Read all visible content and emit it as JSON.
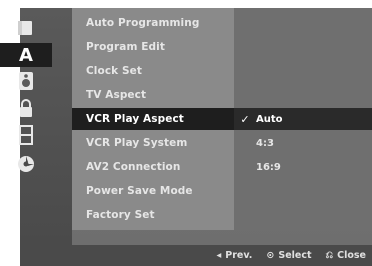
{
  "sidebar": {
    "icons": [
      {
        "name": "disc-icon",
        "active": false
      },
      {
        "name": "language-icon",
        "glyph": "A",
        "active": true
      },
      {
        "name": "audio-icon",
        "active": false
      },
      {
        "name": "lock-icon",
        "active": false
      },
      {
        "name": "film-icon",
        "active": false
      },
      {
        "name": "settings-disc-icon",
        "active": false
      }
    ]
  },
  "menu": {
    "items": [
      {
        "label": "Auto Programming"
      },
      {
        "label": "Program Edit"
      },
      {
        "label": "Clock Set"
      },
      {
        "label": "TV Aspect"
      },
      {
        "label": "VCR Play Aspect",
        "selected": true
      },
      {
        "label": "VCR Play System"
      },
      {
        "label": "AV2 Connection"
      },
      {
        "label": "Power Save Mode"
      },
      {
        "label": "Factory Set"
      }
    ]
  },
  "options": {
    "items": [
      {
        "label": "Auto",
        "checked": true
      },
      {
        "label": "4:3"
      },
      {
        "label": "16:9"
      }
    ]
  },
  "footer": {
    "prev_glyph": "◂",
    "prev_label": "Prev.",
    "select_glyph": "⊙",
    "select_label": "Select",
    "close_glyph": "⎌",
    "close_label": "Close"
  },
  "checkmark": "✓"
}
